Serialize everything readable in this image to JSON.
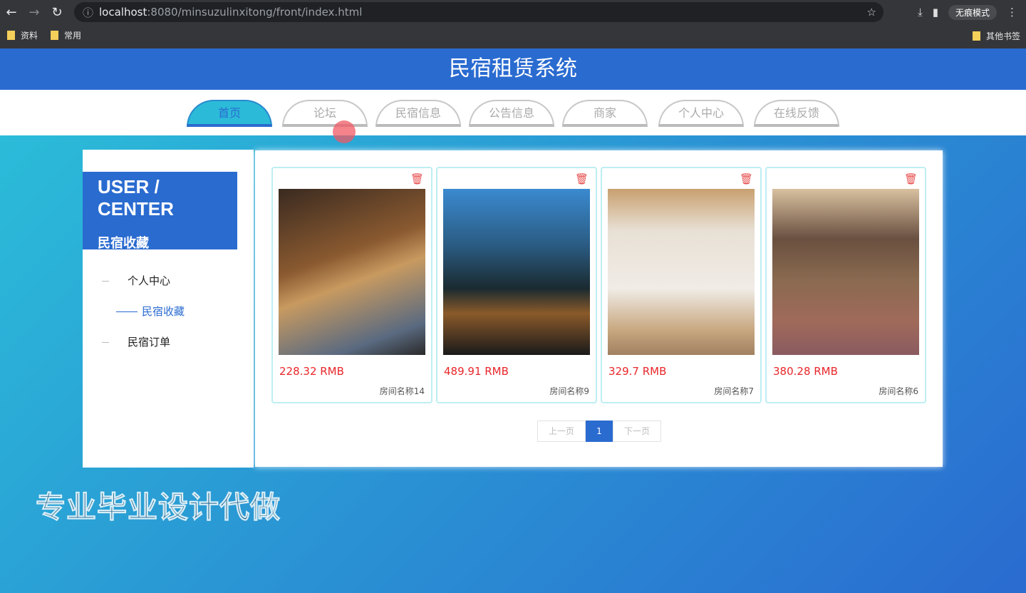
{
  "browser": {
    "url_host": "localhost",
    "url_path": ":8080/minsuzulinxitong/front/index.html",
    "profile": "无痕模式",
    "bookmarks": [
      "资料",
      "常用"
    ],
    "other_bookmarks": "其他书签"
  },
  "header": {
    "title": "民宿租赁系统"
  },
  "nav": {
    "tabs": [
      "首页",
      "论坛",
      "民宿信息",
      "公告信息",
      "商家",
      "个人中心",
      "在线反馈"
    ],
    "active": "首页"
  },
  "sidebar": {
    "title": "USER / CENTER",
    "subtitle": "民宿收藏",
    "items": [
      {
        "label": "个人中心"
      },
      {
        "label": "民宿收藏",
        "active": true
      },
      {
        "label": "民宿订单"
      }
    ]
  },
  "cards": [
    {
      "price": "228.32 RMB",
      "name": "房间名称14"
    },
    {
      "price": "489.91 RMB",
      "name": "房间名称9"
    },
    {
      "price": "329.7 RMB",
      "name": "房间名称7"
    },
    {
      "price": "380.28 RMB",
      "name": "房间名称6"
    }
  ],
  "pagination": {
    "prev": "上一页",
    "current": "1",
    "next": "下一页"
  },
  "watermark": "专业毕业设计代做",
  "colors": {
    "primary": "#2a6bd0",
    "accent": "#2bbbd8",
    "price": "#e8262a"
  }
}
